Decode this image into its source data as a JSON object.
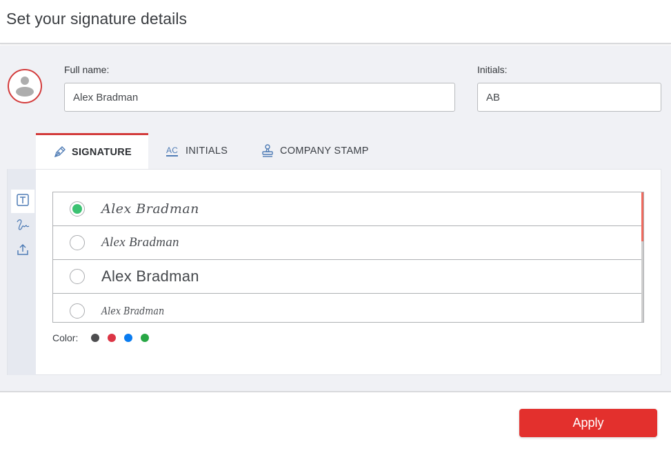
{
  "header": {
    "title": "Set your signature details"
  },
  "form": {
    "full_name_label": "Full name:",
    "full_name_value": "Alex Bradman",
    "initials_label": "Initials:",
    "initials_value": "AB"
  },
  "tabs": [
    {
      "label": "SIGNATURE",
      "icon": "pen-nib-icon",
      "active": true
    },
    {
      "label": "INITIALS",
      "icon": "initials-ac-icon",
      "active": false
    },
    {
      "label": "COMPANY STAMP",
      "icon": "stamp-icon",
      "active": false
    }
  ],
  "side_tools": [
    {
      "name": "type-text-tool",
      "icon": "text-t-icon",
      "active": true
    },
    {
      "name": "draw-tool",
      "icon": "signature-draw-icon",
      "active": false
    },
    {
      "name": "upload-tool",
      "icon": "upload-icon",
      "active": false
    }
  ],
  "signature_options": [
    {
      "text": "Alex Bradman",
      "selected": true
    },
    {
      "text": "Alex Bradman",
      "selected": false
    },
    {
      "text": "Alex Bradman",
      "selected": false
    },
    {
      "text": "Alex Bradman",
      "selected": false
    }
  ],
  "scroll": {
    "position_fraction": 0.0,
    "visible_fraction": 0.38
  },
  "color_picker": {
    "label": "Color:",
    "colors": [
      {
        "name": "dark-gray",
        "hex": "#4d4d4f"
      },
      {
        "name": "red",
        "hex": "#dc3545"
      },
      {
        "name": "blue",
        "hex": "#0a7cf0"
      },
      {
        "name": "green",
        "hex": "#28a745"
      }
    ]
  },
  "colors": {
    "accent": "#d33a3a",
    "selected_radio": "#3cc272",
    "apply_button": "#e3302d",
    "scroll_thumb": "#ef6a5e",
    "icon_blue": "#4f7cb5"
  },
  "footer": {
    "apply_label": "Apply"
  }
}
